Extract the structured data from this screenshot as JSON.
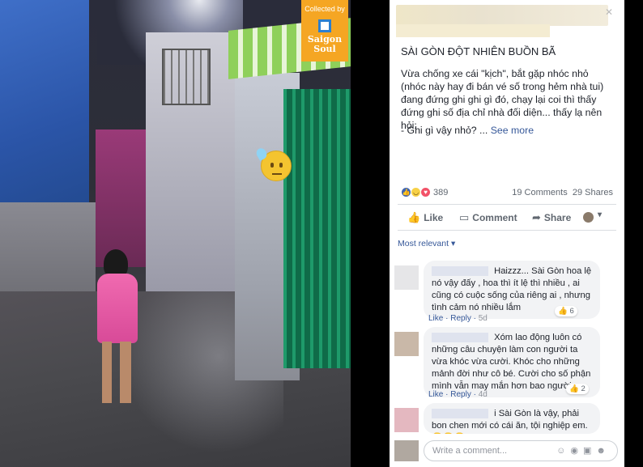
{
  "photo": {
    "badge": {
      "caption": "Collected by",
      "brand_line1": "Saigon",
      "brand_line2": "Soul"
    }
  },
  "post": {
    "title": "SÀI GÒN ĐỘT NHIÊN BUỒN BÃ",
    "body": "Vừa chống xe cái \"kịch\", bắt gặp nhóc nhỏ (nhóc này hay đi bán vé số trong hẻm nhà tui) đang đứng ghi ghi gì đó, chạy lại coi thì thấy đứng ghi số địa chỉ nhà đối diện... thấy lạ nên hỏi:",
    "question": "- Ghi gì vậy nhỏ? ...",
    "see_more": "See more",
    "reaction_count": "389",
    "comments_count": "19 Comments",
    "shares_count": "29 Shares"
  },
  "actions": {
    "like": "Like",
    "comment": "Comment",
    "share": "Share"
  },
  "sort_label": "Most relevant",
  "comments": [
    {
      "text": "Haizzz... Sài Gòn hoa lệ nó vậy đấy , hoa thì ít lệ thì nhiều , ai cũng có cuộc sống của riêng ai , nhưng tình cảm nó nhiều lắm",
      "like": "Like",
      "reply": "Reply",
      "time": "5d",
      "reactions": "6"
    },
    {
      "text": "Xóm lao động luôn có những câu chuyện làm con người ta vừa khóc vừa cười. Khóc cho những mảnh đời như cô bé. Cười cho số phận mình vẫn may mắn hơn bao người",
      "like": "Like",
      "reply": "Reply",
      "time": "4d",
      "reactions": "2"
    },
    {
      "text": "i Sài Gòn là vậy, phải bon chen mới có cái ăn, tội nghiệp em.😂😍😂"
    }
  ],
  "write_placeholder": "Write a comment...",
  "icons": {
    "like": "thumbs-up-icon",
    "comment": "speech-bubble-icon",
    "share": "share-arrow-icon",
    "sort": "caret-down-icon",
    "camera": "camera-icon",
    "emoji": "emoji-icon",
    "gif": "gif-icon",
    "sticker": "sticker-icon"
  },
  "colors": {
    "link": "#365899",
    "badge": "#f5a623",
    "gate": "#1e9a6a"
  }
}
